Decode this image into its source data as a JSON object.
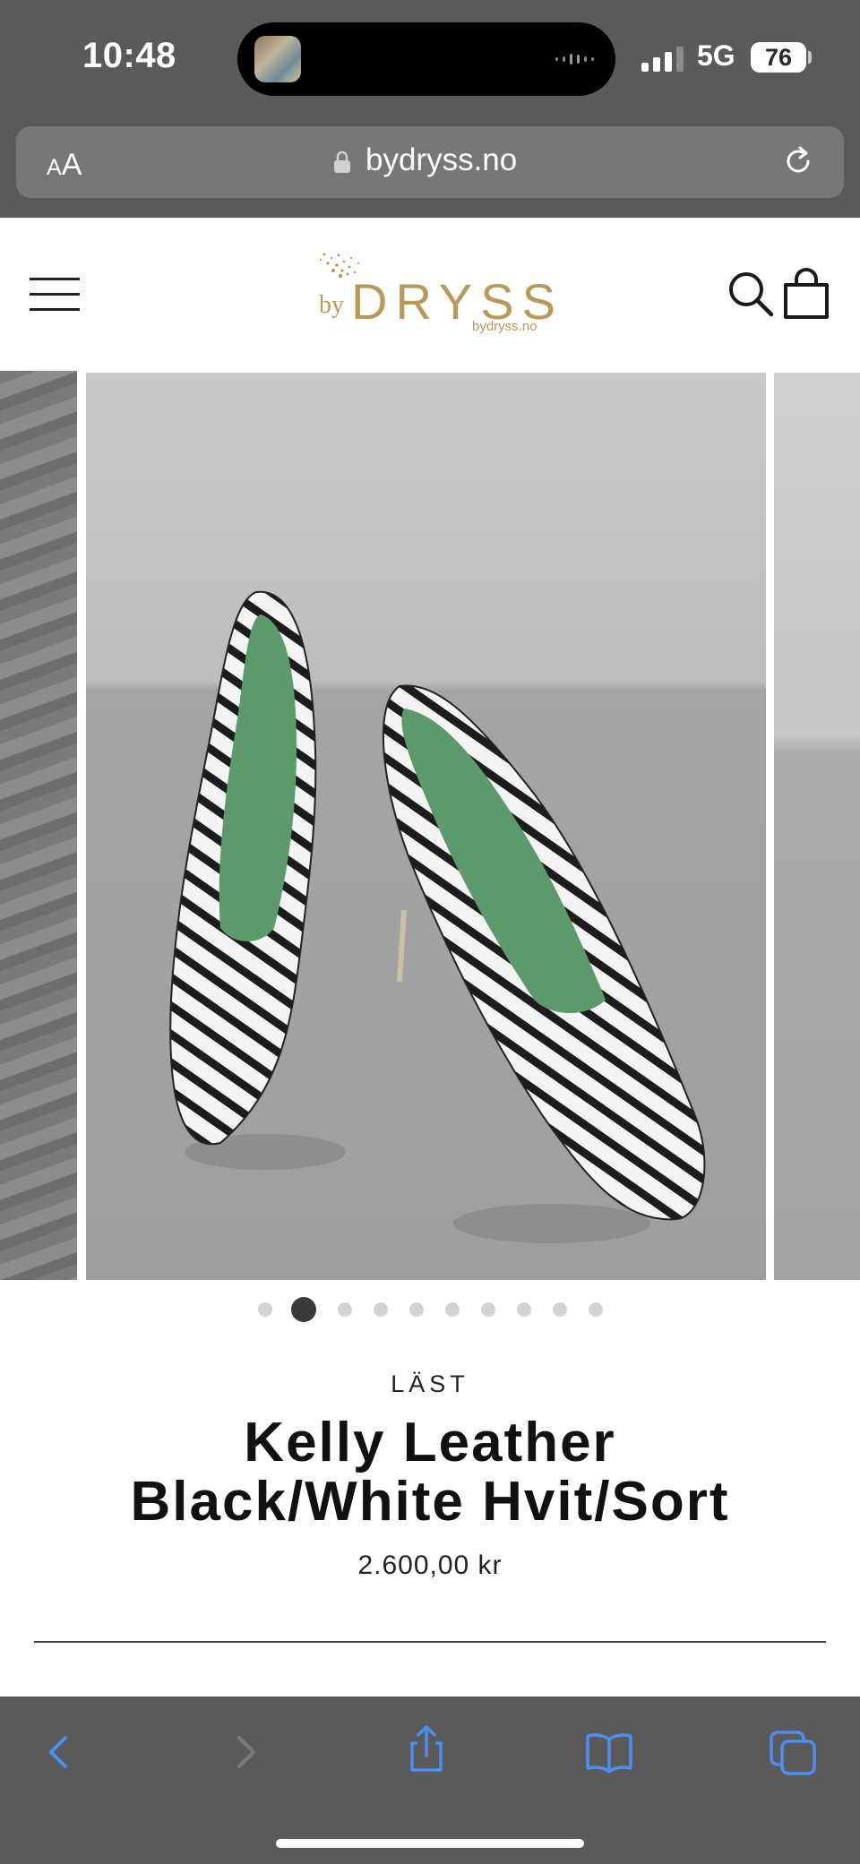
{
  "status_bar": {
    "time": "10:48",
    "network": "5G",
    "battery": "76"
  },
  "browser": {
    "text_size_label_small": "A",
    "text_size_label_large": "A",
    "url": "bydryss.no"
  },
  "site": {
    "logo_prefix": "by",
    "logo_name": "DRYSS",
    "logo_url": "bydryss.no",
    "brand_color": "#b9995a"
  },
  "gallery": {
    "image_count": 10,
    "active_index": 1
  },
  "product": {
    "brand": "LÄST",
    "title_line1": "Kelly Leather",
    "title_line2": "Black/White Hvit/Sort",
    "price": "2.600,00 kr"
  },
  "icons": {
    "menu": "hamburger-menu-icon",
    "search": "search-icon",
    "cart": "shopping-bag-icon",
    "back": "chevron-left-icon",
    "forward": "chevron-right-icon",
    "share": "share-icon",
    "bookmarks": "book-icon",
    "tabs": "tabs-icon",
    "reload": "reload-icon",
    "lock": "lock-icon"
  }
}
